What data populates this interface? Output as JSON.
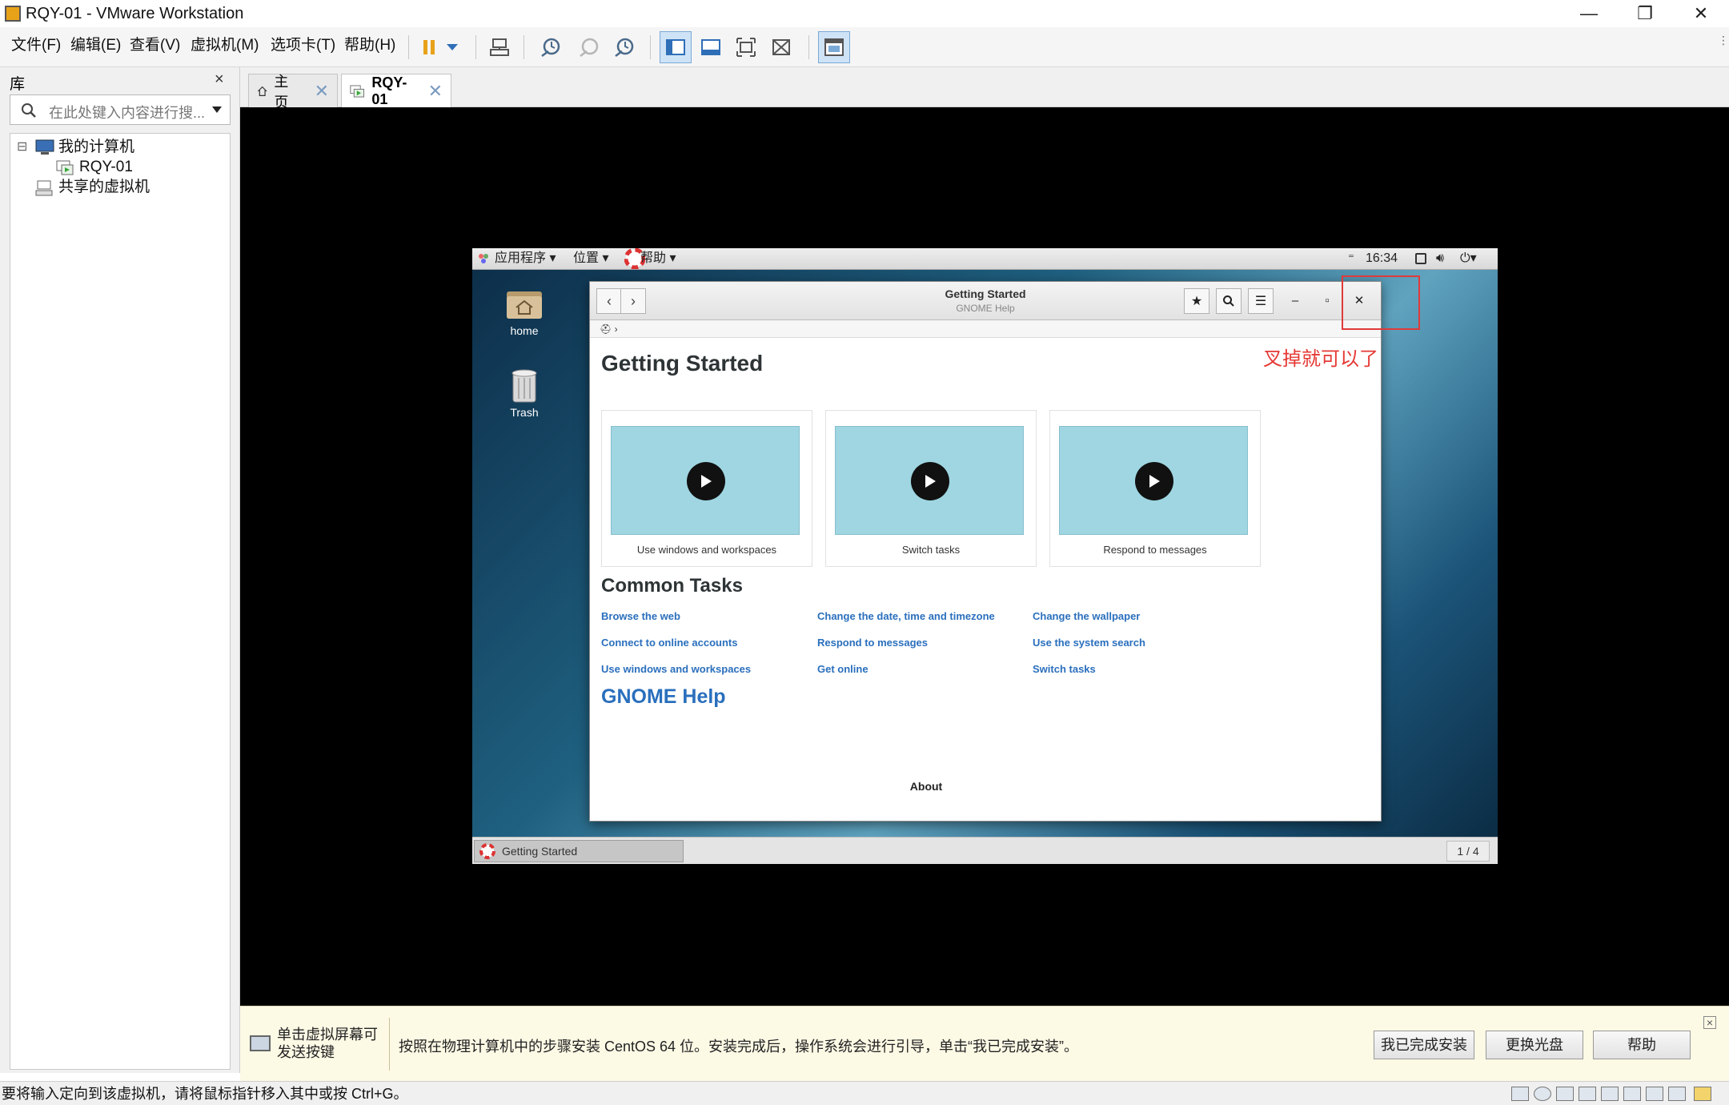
{
  "window": {
    "title": "RQY-01 - VMware Workstation",
    "minimize": "—",
    "restore": "❐",
    "close": "✕"
  },
  "menubar": {
    "items": [
      "文件(F)",
      "编辑(E)",
      "查看(V)",
      "虚拟机(M)",
      "选项卡(T)",
      "帮助(H)"
    ]
  },
  "library": {
    "title": "库",
    "close": "×",
    "search_placeholder": "在此处键入内容进行搜...",
    "tree": [
      {
        "label": "我的计算机",
        "expander": "⊟"
      },
      {
        "label": "RQY-01"
      },
      {
        "label": "共享的虚拟机"
      }
    ]
  },
  "tabs": [
    {
      "label": "主页",
      "close": "✕"
    },
    {
      "label": "RQY-01",
      "close": "✕"
    }
  ],
  "guest": {
    "top_menu": [
      "应用程序 ▾",
      "位置 ▾",
      "帮助 ▾"
    ],
    "clock": "16:34",
    "desktop_icons": [
      "home",
      "Trash"
    ],
    "taskbar_item": "Getting Started",
    "workspace": "1 / 4",
    "help_window": {
      "title": "Getting Started",
      "subtitle": "GNOME Help",
      "breadcrumb": "›",
      "heading": "Getting Started",
      "videos": [
        "Use windows and workspaces",
        "Switch tasks",
        "Respond to messages"
      ],
      "common_tasks_heading": "Common Tasks",
      "tasks": [
        [
          "Browse the web",
          "Change the date, time and timezone",
          "Change the wallpaper"
        ],
        [
          "Connect to online accounts",
          "Respond to messages",
          "Use the system search"
        ],
        [
          "Use windows and workspaces",
          "Get online",
          "Switch tasks"
        ]
      ],
      "gnome_help": "GNOME Help",
      "about": "About",
      "buttons": {
        "back": "‹",
        "forward": "›",
        "bookmark": "★",
        "menu": "☰",
        "minimize": "‒",
        "maximize": "▫",
        "close": "✕"
      }
    }
  },
  "annotation": {
    "text": "叉掉就可以了",
    "color": "#e53935"
  },
  "install_bar": {
    "hint": "单击虚拟屏幕可发送按键",
    "message": "按照在物理计算机中的步骤安装 CentOS 64 位。安装完成后，操作系统会进行引导，单击“我已完成安装”。",
    "buttons": [
      "我已完成安装",
      "更换光盘",
      "帮助"
    ],
    "close": "×"
  },
  "statusbar": {
    "text": "要将输入定向到该虚拟机，请将鼠标指针移入其中或按 Ctrl+G。"
  }
}
